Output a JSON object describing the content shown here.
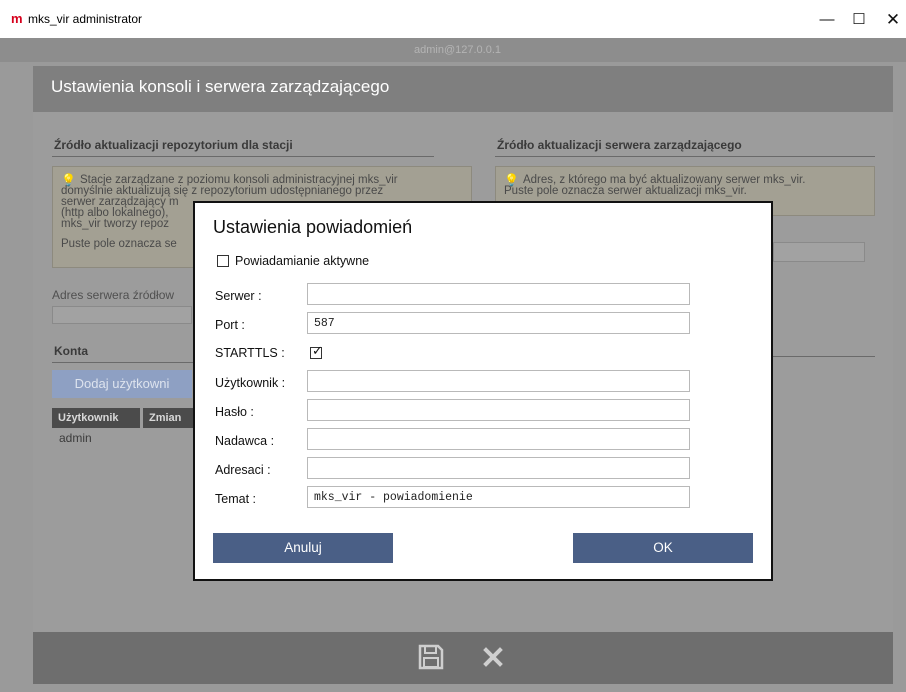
{
  "window": {
    "logo": "m",
    "title": "mks_vir administrator",
    "min_glyph": "—",
    "max_glyph": "☐",
    "close_glyph": "✕"
  },
  "background": {
    "host": "admin@127.0.0.1",
    "panel_title": "Ustawienia konsoli i serwera zarządzającego",
    "left_section_title": "Źródło aktualizacji repozytorium dla stacji",
    "left_info_lines": [
      "Stacje zarządzane z poziomu konsoli administracyjnej mks_vir",
      "domyślnie aktualizują się z repozytorium udostępnianego przez",
      "serwer zarządzający m",
      "(http albo lokalnego),",
      "mks_vir tworzy repoz"
    ],
    "left_info_empty": "Puste pole oznacza se",
    "source_server_label": "Adres serwera źródłow",
    "accounts_title": "Konta",
    "add_user_button": "Dodaj użytkowni",
    "table_headers": [
      "Użytkownik",
      "Zmian"
    ],
    "table_rows": [
      [
        "admin"
      ]
    ],
    "right_section_title": "Źródło aktualizacji serwera zarządzającego",
    "right_info_lines": [
      "Adres, z którego ma być aktualizowany serwer mks_vir.",
      "Puste pole oznacza serwer aktualizacji mks_vir."
    ],
    "footer_icons": [
      "save-icon",
      "close-icon"
    ]
  },
  "modal": {
    "title": "Ustawienia powiadomień",
    "notifications_active_label": "Powiadamianie aktywne",
    "notifications_active": false,
    "fields": {
      "server": {
        "label": "Serwer :",
        "value": ""
      },
      "port": {
        "label": "Port :",
        "value": "587"
      },
      "starttls": {
        "label": "STARTTLS :",
        "checked": true
      },
      "user": {
        "label": "Użytkownik :",
        "value": ""
      },
      "password": {
        "label": "Hasło :",
        "value": ""
      },
      "sender": {
        "label": "Nadawca :",
        "value": ""
      },
      "recipients": {
        "label": "Adresaci :",
        "value": ""
      },
      "subject": {
        "label": "Temat :",
        "value": "mks_vir - powiadomienie"
      }
    },
    "check_glyph": "✓",
    "cancel_label": "Anuluj",
    "ok_label": "OK"
  },
  "colors": {
    "accent_button": "#4a5f86",
    "logo": "#d6001c"
  }
}
